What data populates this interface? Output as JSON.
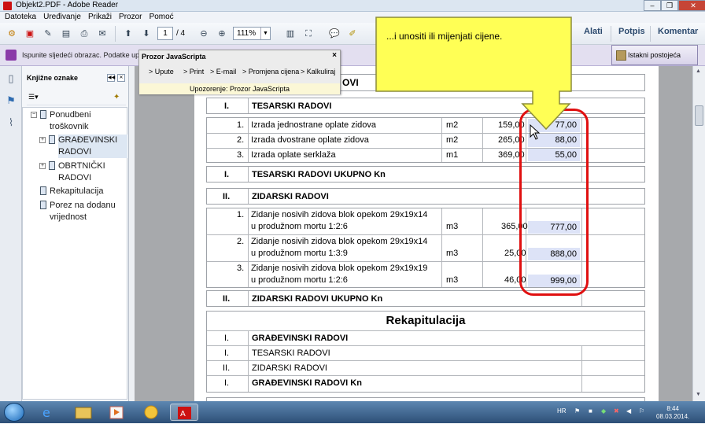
{
  "window": {
    "title": "Objekt2.PDF - Adobe Reader"
  },
  "menu": [
    "Datoteka",
    "Uređivanje",
    "Prikaži",
    "Prozor",
    "Pomoć"
  ],
  "toolbar": {
    "page_current": "1",
    "page_total": "/ 4",
    "zoom": "111%",
    "tabs": [
      "Alati",
      "Potpis",
      "Komentar"
    ]
  },
  "formbar": {
    "message": "Ispunite sljedeći obrazac. Podatke upisa",
    "highlight_button": "Istakni postojeća polja"
  },
  "bookmarks": {
    "title": "Knjižne oznake",
    "items": [
      {
        "label": "Ponudbeni troškovnik"
      },
      {
        "label": "GRAĐEVINSKI RADOVI"
      },
      {
        "label": "OBRTNIČKI RADOVI"
      },
      {
        "label": "Rekapitulacija"
      },
      {
        "label": "Porez na dodanu vrijednost"
      }
    ]
  },
  "js_popup": {
    "title": "Prozor JavaScripta",
    "close": "×",
    "items": [
      "> Upute",
      "> Print",
      "> E-mail",
      "> Promjena cijena",
      "> Kalkuliraj"
    ],
    "warning": "Upozorenje: Prozor JavaScripta"
  },
  "callout": {
    "text": "...i unositi ili mijenjati cijene."
  },
  "doc": {
    "top_header_tail": "OVI",
    "tesarski": {
      "roman": "I.",
      "title": "TESARSKI RADOVI",
      "rows": [
        {
          "no": "1.",
          "desc": "Izrada jednostrane oplate zidova",
          "unit": "m2",
          "qty": "159,00",
          "price": "77,00"
        },
        {
          "no": "2.",
          "desc": "Izrada dvostrane oplate zidova",
          "unit": "m2",
          "qty": "265,00",
          "price": "88,00"
        },
        {
          "no": "3.",
          "desc": "Izrada oplate serklaža",
          "unit": "m1",
          "qty": "369,00",
          "price": "55,00"
        }
      ],
      "total_roman": "I.",
      "total_label": "TESARSKI RADOVI UKUPNO Kn"
    },
    "zidarski": {
      "roman": "II.",
      "title": "ZIDARSKI RADOVI",
      "rows": [
        {
          "no": "1.",
          "desc1": "Zidanje nosivih zidova blok opekom 29x19x14",
          "desc2": "u produžnom mortu 1:2:6",
          "unit": "m3",
          "qty": "365,00",
          "price": "777,00"
        },
        {
          "no": "2.",
          "desc1": "Zidanje nosivih zidova blok opekom 29x19x14",
          "desc2": "u produžnom mortu 1:3:9",
          "unit": "m3",
          "qty": "25,00",
          "price": "888,00"
        },
        {
          "no": "3.",
          "desc1": "Zidanje nosivih zidova blok opekom 29x19x19",
          "desc2": "u produžnom mortu 1:2:6",
          "unit": "m3",
          "qty": "46,00",
          "price": "999,00"
        }
      ],
      "total_roman": "II.",
      "total_label": "ZIDARSKI RADOVI UKUPNO Kn"
    },
    "rekap": {
      "title": "Rekapitulacija",
      "rows": [
        {
          "roman": "I.",
          "label": "GRAĐEVINSKI RADOVI",
          "bold": true
        },
        {
          "roman": "I.",
          "label": "TESARSKI RADOVI",
          "bold": false
        },
        {
          "roman": "II.",
          "label": "ZIDARSKI RADOVI",
          "bold": false
        },
        {
          "roman": "I.",
          "label": "GRAĐEVINSKI RADOVI Kn",
          "bold": true
        }
      ]
    }
  },
  "taskbar": {
    "lang": "HR",
    "time": "8:44",
    "date": "08.03.2014."
  }
}
